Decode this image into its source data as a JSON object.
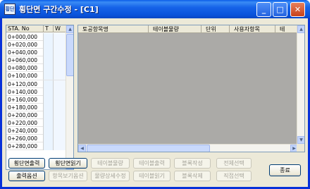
{
  "window": {
    "title": "횡단면 구간수정 - [C1]",
    "app_icon": "횡단"
  },
  "caption_buttons": {
    "minimize": "_",
    "maximize": "□",
    "close": "✕"
  },
  "station_list": {
    "headers": [
      "STA. No",
      "T",
      "W"
    ],
    "rows": [
      "0+000,000",
      "0+020,000",
      "0+040,000",
      "0+060,000",
      "0+080,000",
      "0+100,000",
      "0+120,000",
      "0+140,000",
      "0+160,000",
      "0+180,000",
      "0+200,000",
      "0+220,000",
      "0+240,000",
      "0+260,000",
      "0+280,000"
    ]
  },
  "main_table": {
    "headers": [
      "토공항목명",
      "테이블물량",
      "단위",
      "사용자항목",
      "테"
    ]
  },
  "buttons": {
    "row1": [
      {
        "label": "횡단면출력",
        "enabled": true
      },
      {
        "label": "횡단면읽기",
        "enabled": true
      },
      {
        "label": "테이블물량",
        "enabled": false
      },
      {
        "label": "테이블출력",
        "enabled": false
      },
      {
        "label": "블록작성",
        "enabled": false
      },
      {
        "label": "전체선택",
        "enabled": false
      }
    ],
    "row2": [
      {
        "label": "출력옵션",
        "enabled": true
      },
      {
        "label": "항목보기옵션",
        "enabled": false
      },
      {
        "label": "물량상세수정",
        "enabled": false
      },
      {
        "label": "테이블읽기",
        "enabled": false
      },
      {
        "label": "블록삭제",
        "enabled": false
      },
      {
        "label": "직접선택",
        "enabled": false
      }
    ],
    "close": "종료"
  }
}
